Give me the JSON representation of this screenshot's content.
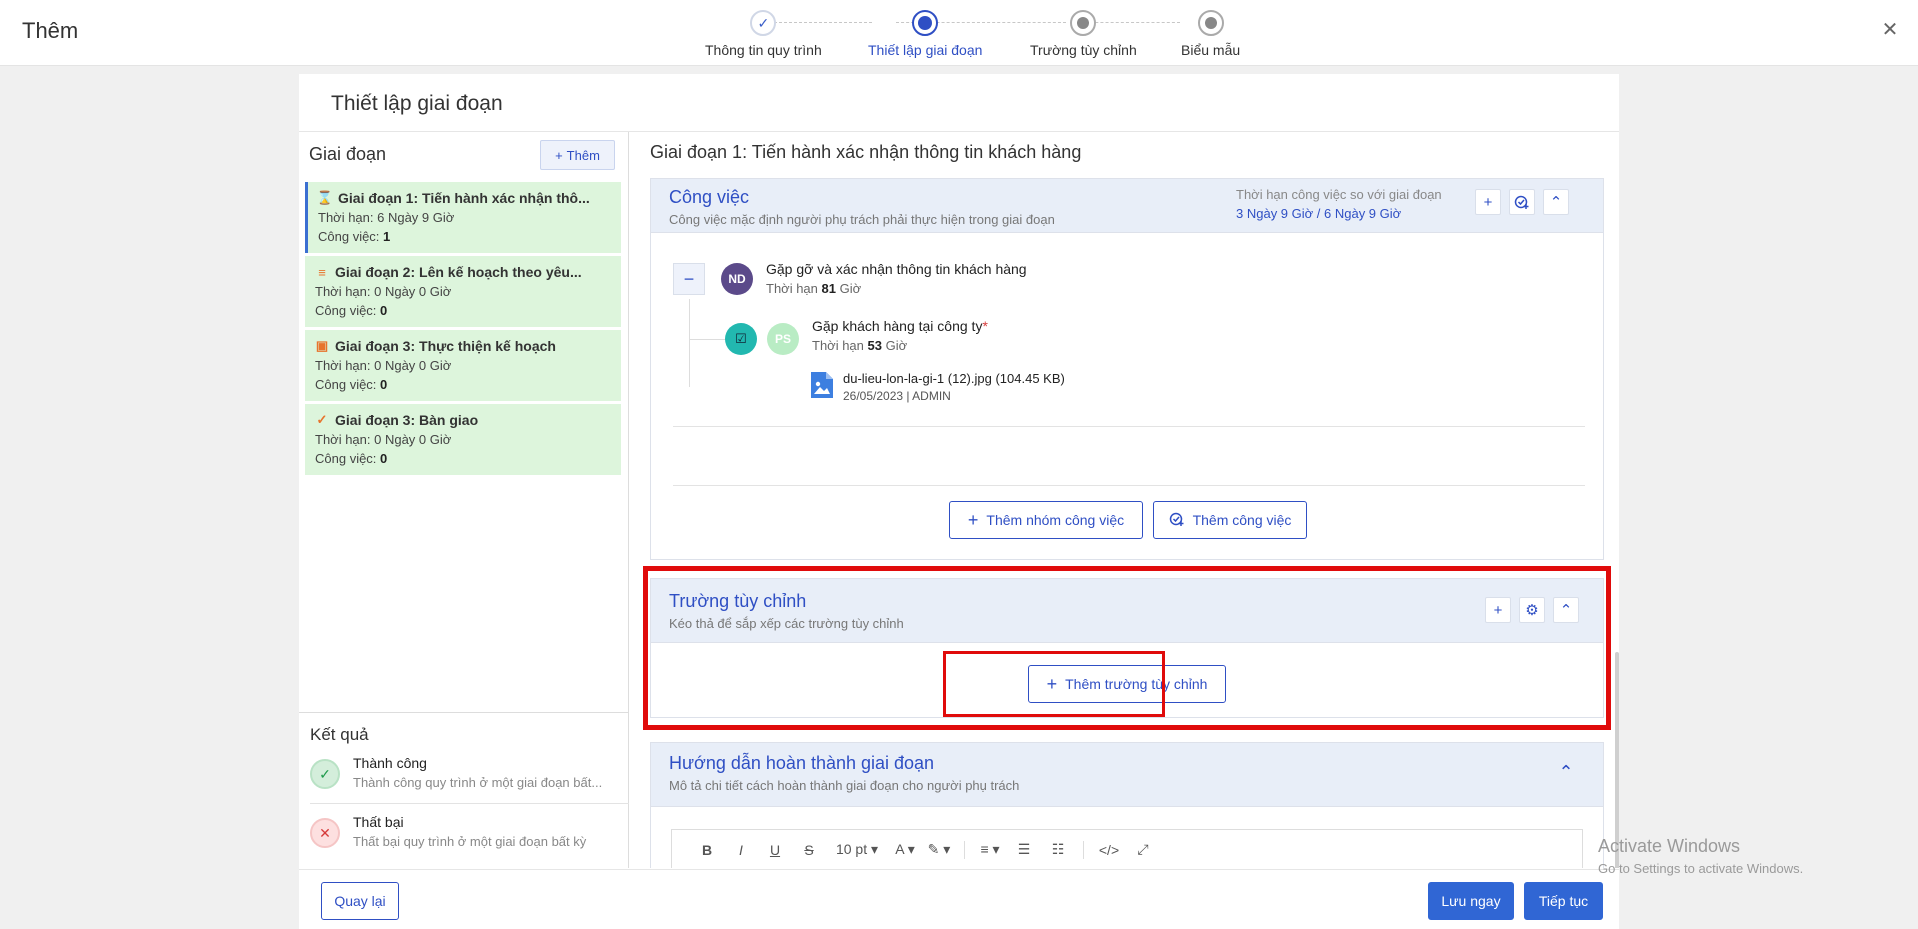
{
  "header": {
    "title": "Thêm",
    "close_icon": "close-icon",
    "steps": [
      {
        "label": "Thông tin quy trình",
        "state": "done"
      },
      {
        "label": "Thiết lập giai đoạn",
        "state": "active"
      },
      {
        "label": "Trường tùy chỉnh",
        "state": "todo"
      },
      {
        "label": "Biểu mẫu",
        "state": "todo"
      }
    ]
  },
  "panel": {
    "title": "Thiết lập giai đoạn"
  },
  "stages": {
    "heading": "Giai đoạn",
    "add_label": "Thêm",
    "items": [
      {
        "title": "Giai đoạn 1: Tiến hành xác nhận thô...",
        "deadline_prefix": "Thời hạn: ",
        "deadline": "6 Ngày 9 Giờ",
        "tasks_prefix": "Công việc: ",
        "tasks": "1",
        "icon": "hourglass-icon"
      },
      {
        "title": "Giai đoạn 2: Lên kế hoạch theo yêu...",
        "deadline_prefix": "Thời hạn: ",
        "deadline": "0 Ngày 0 Giờ",
        "tasks_prefix": "Công việc: ",
        "tasks": "0",
        "icon": "list-icon"
      },
      {
        "title": "Giai đoạn 3: Thực thiện kế hoạch",
        "deadline_prefix": "Thời hạn: ",
        "deadline": "0 Ngày 0 Giờ",
        "tasks_prefix": "Công việc: ",
        "tasks": "0",
        "icon": "calendar-check-icon"
      },
      {
        "title": "Giai đoạn 3: Bàn giao",
        "deadline_prefix": "Thời hạn: ",
        "deadline": "0 Ngày 0 Giờ",
        "tasks_prefix": "Công việc: ",
        "tasks": "0",
        "icon": "check-icon"
      }
    ]
  },
  "results": {
    "heading": "Kết quả",
    "items": [
      {
        "name": "Thành công",
        "desc": "Thành công quy trình ở một giai đoạn bất..."
      },
      {
        "name": "Thất bại",
        "desc": "Thất bại quy trình ở một giai đoạn bất kỳ"
      }
    ]
  },
  "detail": {
    "stage_heading": "Giai đoạn 1: Tiến hành xác nhận thông tin khách hàng",
    "tasks_card": {
      "title": "Công việc",
      "subtitle": "Công việc mặc định người phụ trách phải thực hiện trong giai đoạn",
      "deadline_label": "Thời hạn công việc so với giai đoạn",
      "deadline_value": "3 Ngày 9 Giờ / 6 Ngày 9 Giờ",
      "group": {
        "avatar": "ND",
        "name": "Gặp gỡ và xác nhận thông tin khách hàng",
        "deadline_prefix": "Thời hạn ",
        "deadline_num": "81",
        "deadline_unit": " Giờ"
      },
      "task": {
        "avatar": "PS",
        "name": "Gặp khách hàng tại công ty",
        "required_mark": "*",
        "deadline_prefix": "Thời hạn ",
        "deadline_num": "53",
        "deadline_unit": " Giờ"
      },
      "file": {
        "name": "du-lieu-lon-la-gi-1 (12).jpg (104.45 KB)",
        "meta": "26/05/2023 | ADMIN"
      },
      "add_group_label": "Thêm nhóm công việc",
      "add_task_label": "Thêm công việc"
    },
    "custom_fields_card": {
      "title": "Trường tùy chỉnh",
      "subtitle": "Kéo thả để sắp xếp các trường tùy chỉnh",
      "add_label": "Thêm trường tùy chỉnh"
    },
    "guide_card": {
      "title": "Hướng dẫn hoàn thành giai đoạn",
      "subtitle": "Mô tả chi tiết cách hoàn thành giai đoạn cho người phụ trách",
      "font_size": "10 pt"
    }
  },
  "footer": {
    "back_label": "Quay lại",
    "save_label": "Lưu ngay",
    "next_label": "Tiếp tục"
  },
  "watermark": {
    "line1": "Activate Windows",
    "line2": "Go to Settings to activate Windows."
  },
  "colors": {
    "accent": "#2f4fc4",
    "stage_bg": "#ddf5dc",
    "highlight": "#e00b0b"
  }
}
